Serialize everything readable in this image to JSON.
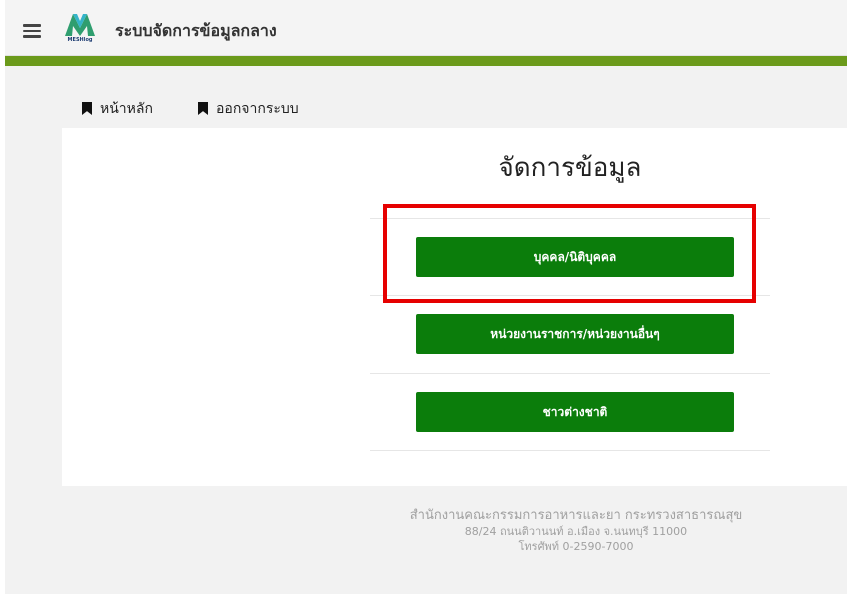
{
  "header": {
    "logo_text": "MESHlog",
    "app_title": "ระบบจัดการข้อมูลกลาง"
  },
  "nav": {
    "items": [
      {
        "label": "หน้าหลัก",
        "icon": "bookmark-icon"
      },
      {
        "label": "ออกจากระบบ",
        "icon": "bookmark-icon"
      }
    ]
  },
  "main": {
    "title": "จัดการข้อมูล",
    "buttons": [
      {
        "label": "บุคคล/นิติบุคคล"
      },
      {
        "label": "หน่วยงานราชการ/หน่วยงานอื่นๆ"
      },
      {
        "label": "ชาวต่างชาติ"
      }
    ]
  },
  "footer": {
    "line1": "สำนักงานคณะกรรมการอาหารและยา กระทรวงสาธารณสุข",
    "line2": "88/24 ถนนติวานนท์ อ.เมือง จ.นนทบุรี 11000",
    "line3": "โทรศัพท์ 0-2590-7000"
  },
  "colors": {
    "accent_green_band": "#6b9a1b",
    "button_green": "#0b7d0b",
    "highlight_red": "#e60000"
  }
}
